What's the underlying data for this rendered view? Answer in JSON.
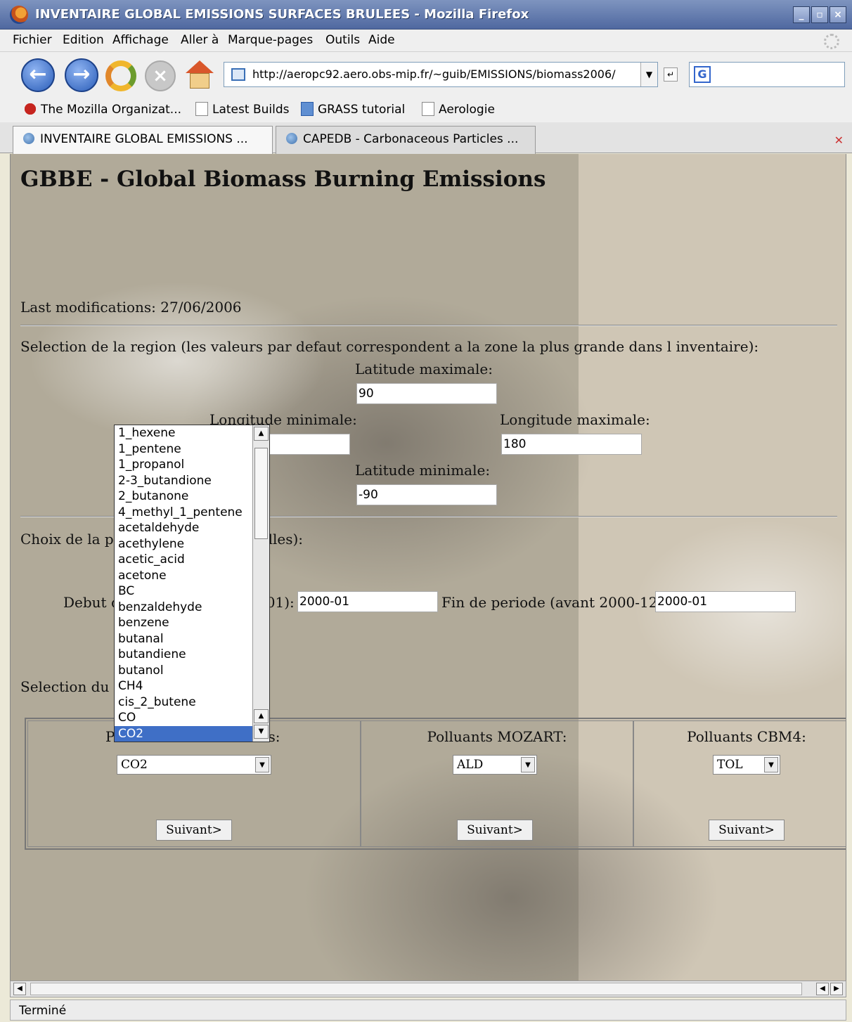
{
  "window": {
    "title": "INVENTAIRE GLOBAL EMISSIONS SURFACES BRULEES - Mozilla Firefox"
  },
  "menu": [
    "Fichier",
    "Edition",
    "Affichage",
    "Aller à",
    "Marque-pages",
    "Outils",
    "Aide"
  ],
  "toolbar": {
    "url": "http://aeropc92.aero.obs-mip.fr/~guib/EMISSIONS/biomass2006/",
    "search_value": ""
  },
  "bookmarks": [
    "The Mozilla Organizat...",
    "Latest Builds",
    "GRASS tutorial",
    "Aerologie"
  ],
  "tabs": [
    "INVENTAIRE GLOBAL EMISSIONS ...",
    "CAPEDB - Carbonaceous Particles ..."
  ],
  "page": {
    "title": "GBBE - Global Biomass Burning Emissions",
    "last_modified": "Last modifications: 27/06/2006",
    "region_label": "Selection de la region (les valeurs par defaut correspondent a la zone la plus grande dans l inventaire):",
    "lat_max_label": "Latitude maximale:",
    "lat_max_value": "90",
    "lon_min_label": "Longitude minimale:",
    "lon_max_label": "Longitude maximale:",
    "lon_max_value": "180",
    "lat_min_label": "Latitude minimale:",
    "lat_min_value": "-90",
    "period_label_part1": "Choix de la pe",
    "period_label_part2": "lles):",
    "debut_label_part1": "Debut d",
    "debut_label_part2": "01):",
    "debut_value": "2000-01",
    "fin_label": "Fin de periode (avant 2000-12):",
    "fin_value": "2000-01",
    "pollutant_label_part1": "Selection du p",
    "col1_title_part1": "P",
    "col1_title_part2": "s:",
    "col1_select_value": "CO2",
    "col2_title": "Polluants MOZART:",
    "col2_select_value": "ALD",
    "col3_title": "Polluants CBM4:",
    "col3_select_value": "TOL",
    "next_button": "Suivant>"
  },
  "dropdown_options": [
    "1_hexene",
    "1_pentene",
    "1_propanol",
    "2-3_butandione",
    "2_butanone",
    "4_methyl_1_pentene",
    "acetaldehyde",
    "acethylene",
    "acetic_acid",
    "acetone",
    "BC",
    "benzaldehyde",
    "benzene",
    "butanal",
    "butandiene",
    "butanol",
    "CH4",
    "cis_2_butene",
    "CO",
    "CO2"
  ],
  "dropdown_selected": "CO2",
  "status": "Terminé"
}
